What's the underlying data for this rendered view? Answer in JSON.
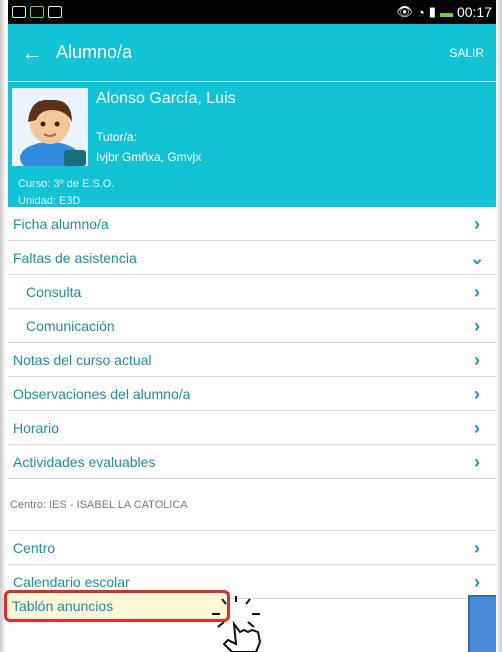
{
  "status_bar": {
    "time": "00:17",
    "left_icons": [
      "image-icon",
      "message-icon",
      "file-icon"
    ],
    "right_icons": [
      "eye-icon",
      "wifi-icon",
      "signal-icon",
      "battery-icon"
    ]
  },
  "app_bar": {
    "title": "Alumno/a",
    "action": "SALIR"
  },
  "profile": {
    "name": "Alonso García, Luis",
    "tutor_label": "Tutor/a:",
    "tutor_name": "Ivjbr Gmñxa, Gmvjx",
    "curso": "Curso:  3º de E.S.O.",
    "unidad": "Unidad: E3D"
  },
  "menu": {
    "items": [
      {
        "label": "Ficha alumno/a"
      },
      {
        "label": "Faltas de asistencia"
      },
      {
        "label": "Consulta"
      },
      {
        "label": "Comunicación"
      },
      {
        "label": "Notas del curso actual"
      },
      {
        "label": "Observaciones del alumno/a"
      },
      {
        "label": "Horario"
      },
      {
        "label": "Actividades evaluables"
      }
    ],
    "section": "Centro: IES - ISABEL LA CATOLICA",
    "center_items": [
      {
        "label": "Centro"
      },
      {
        "label": "Calendario escolar"
      }
    ],
    "highlighted": {
      "label": "Tablón anuncios"
    }
  },
  "colors": {
    "accent": "#11c3d4",
    "link": "#1f8ea3",
    "chevron": "#1a91c9",
    "highlight_border": "#e12a2a",
    "highlight_fill": "#fdf8d6"
  }
}
